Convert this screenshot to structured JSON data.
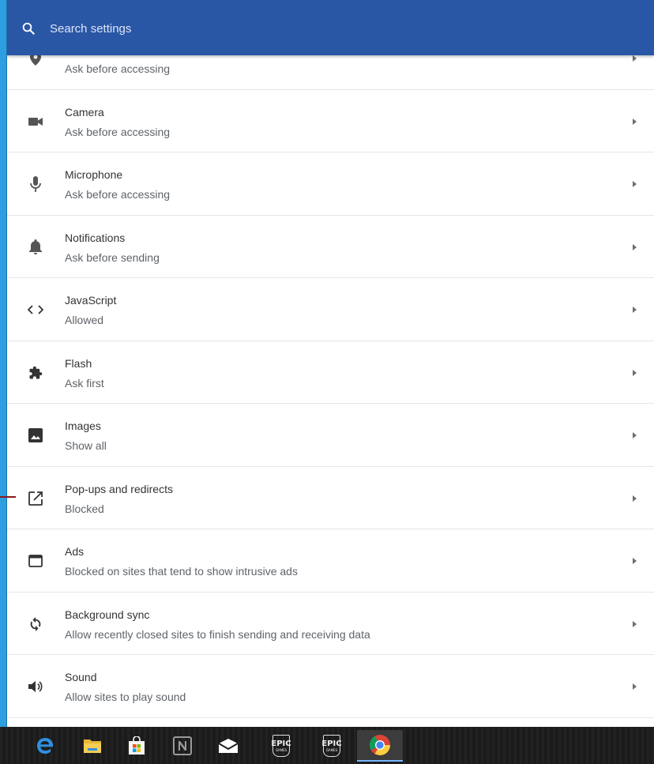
{
  "search": {
    "placeholder": "Search settings"
  },
  "settings": [
    {
      "title": "",
      "subtitle": "Ask before accessing",
      "icon": "location-icon"
    },
    {
      "title": "Camera",
      "subtitle": "Ask before accessing",
      "icon": "camera-icon"
    },
    {
      "title": "Microphone",
      "subtitle": "Ask before accessing",
      "icon": "microphone-icon"
    },
    {
      "title": "Notifications",
      "subtitle": "Ask before sending",
      "icon": "bell-icon"
    },
    {
      "title": "JavaScript",
      "subtitle": "Allowed",
      "icon": "code-icon"
    },
    {
      "title": "Flash",
      "subtitle": "Ask first",
      "icon": "puzzle-icon"
    },
    {
      "title": "Images",
      "subtitle": "Show all",
      "icon": "image-icon"
    },
    {
      "title": "Pop-ups and redirects",
      "subtitle": "Blocked",
      "icon": "open-in-new-icon"
    },
    {
      "title": "Ads",
      "subtitle": "Blocked on sites that tend to show intrusive ads",
      "icon": "window-icon"
    },
    {
      "title": "Background sync",
      "subtitle": "Allow recently closed sites to finish sending and receiving data",
      "icon": "sync-icon"
    },
    {
      "title": "Sound",
      "subtitle": "Allow sites to play sound",
      "icon": "speaker-icon"
    }
  ],
  "taskbar": {
    "epic_label": "EPIC",
    "epic_sub": "GAMES",
    "items": [
      "edge-icon",
      "file-explorer-icon",
      "store-icon",
      "onenote-icon",
      "mail-icon",
      "epic-games-icon",
      "epic-games-icon",
      "chrome-icon"
    ]
  },
  "colors": {
    "header": "#2a56a6",
    "accent_line": "#8b1a1a"
  }
}
